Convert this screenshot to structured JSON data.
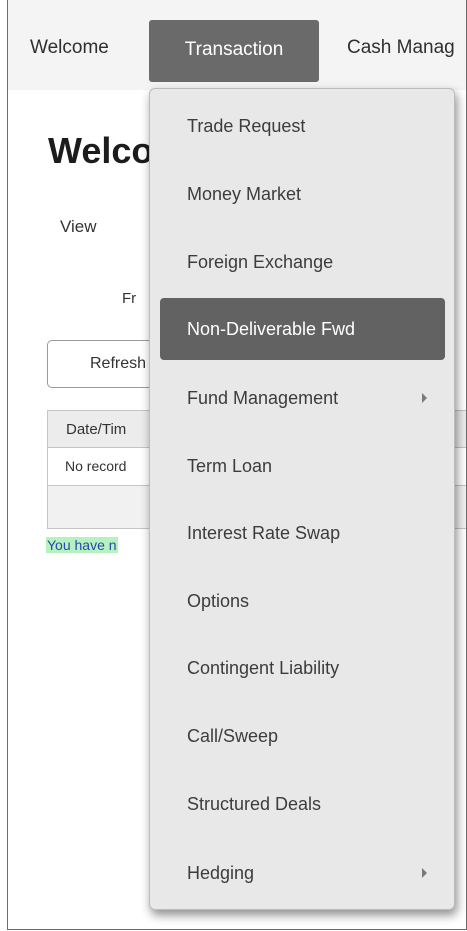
{
  "nav": {
    "items": [
      {
        "label": "Welcome"
      },
      {
        "label": "Transaction"
      },
      {
        "label": "Cash Manag"
      }
    ]
  },
  "page": {
    "title": "Welco",
    "view_label": "View",
    "from_label": "Fr",
    "refresh_label": "Refresh",
    "table": {
      "header": "Date/Tim",
      "empty_row": "No record"
    },
    "message": "You have n"
  },
  "dropdown": {
    "active_item": "Non-Deliverable Fwd",
    "items": [
      {
        "label": "Trade Request"
      },
      {
        "label": "Money Market"
      },
      {
        "label": "Foreign Exchange"
      },
      {
        "label": "Non-Deliverable Fwd"
      },
      {
        "label": "Fund Management"
      },
      {
        "label": "Term Loan"
      },
      {
        "label": "Interest Rate Swap"
      },
      {
        "label": "Options"
      },
      {
        "label": "Contingent Liability"
      },
      {
        "label": "Call/Sweep"
      },
      {
        "label": "Structured Deals"
      },
      {
        "label": "Hedging"
      }
    ]
  },
  "colors": {
    "nav_active_bg": "#6a6a6a",
    "menu_bg": "#e8e8e8",
    "menu_active_bg": "#626262",
    "message_highlight": "#b6f2c0",
    "message_text": "#2a46b0"
  }
}
